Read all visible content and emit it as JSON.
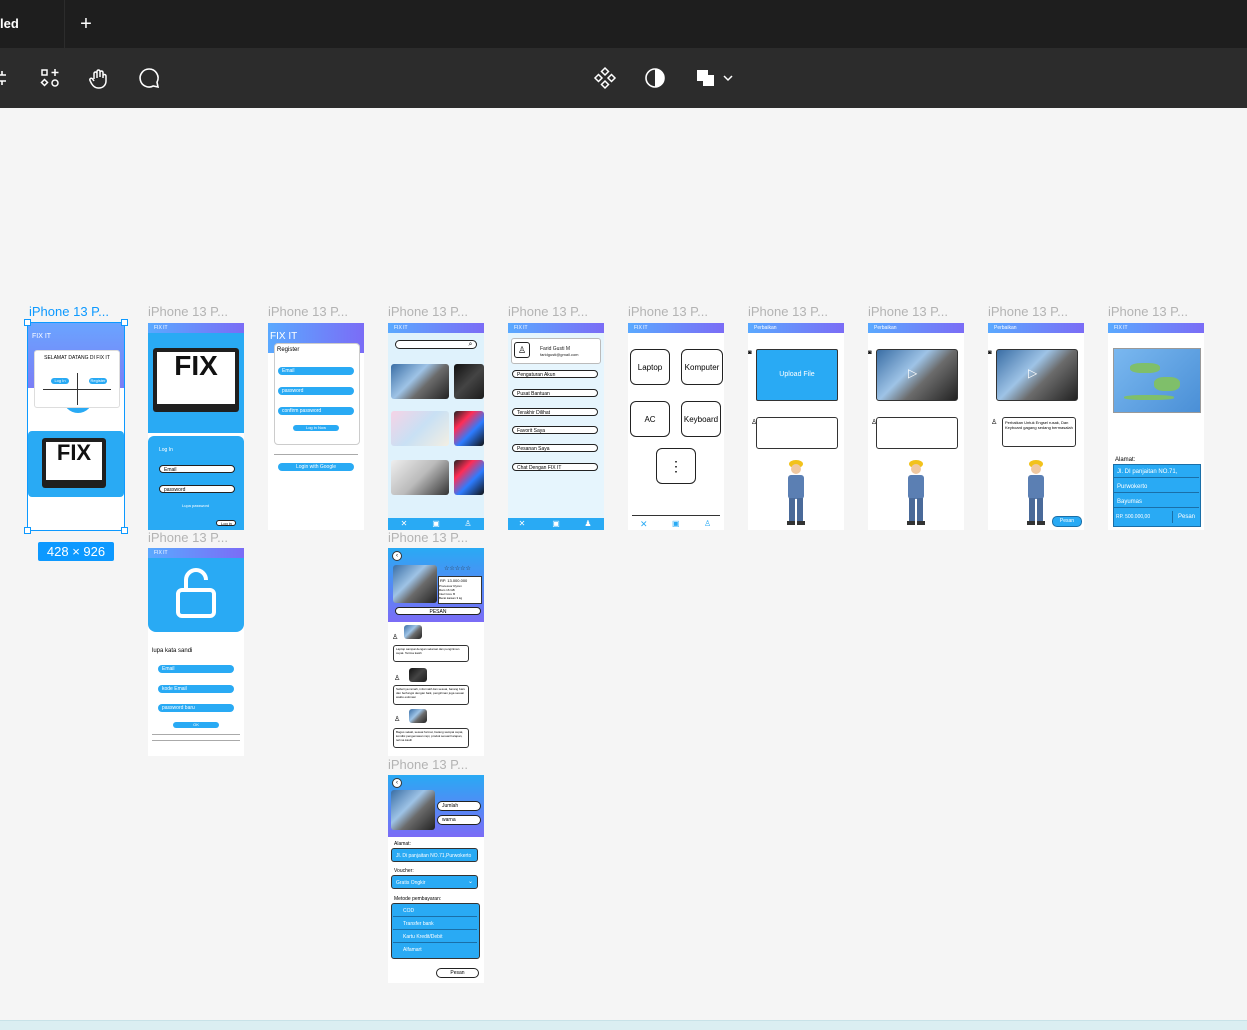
{
  "tabs": {
    "active": "led",
    "add": "+"
  },
  "toolbar": {
    "left_icons": [
      "frame-icon",
      "components-icon",
      "hand-icon",
      "comment-icon"
    ],
    "right_icons": [
      "component-diamond-icon",
      "contrast-icon",
      "boolean-shapes-icon",
      "chevron-down-icon"
    ]
  },
  "frames": {
    "label": "iPhone 13 P...",
    "dimensions": "428 × 926"
  },
  "f1": {
    "brand": "FIX IT",
    "welcome": "SELAMAT DATANG DI FIX IT",
    "login": "Log In",
    "register": "Register"
  },
  "f2": {
    "brand": "FIX IT",
    "title": "Log In",
    "email": "Email",
    "password": "password",
    "forgot": "Lupa password",
    "login": "Log in"
  },
  "f3": {
    "brand": "FIX IT",
    "title": "Register",
    "email": "Email",
    "password": "password",
    "confirm": "confirm password",
    "submit": "Log in Now",
    "google": "Login with Google"
  },
  "f4": {
    "brand": "FIX IT"
  },
  "f5": {
    "brand": "FIX IT",
    "user": "Farid Gusti M",
    "email": "faridgusti@gmail.com",
    "menu": [
      "Pengaturan Akun",
      "Pusat Bantuan",
      "Terakhir Dilihat",
      "Favorit Saya",
      "Pesanan Saya",
      "Chat Dengan FIX IT"
    ]
  },
  "f6": {
    "brand": "FIX IT",
    "tiles": [
      "Laptop",
      "Komputer",
      "AC",
      "Keyboard"
    ]
  },
  "f7": {
    "brand": "Perbaikan",
    "upload": "Upload File"
  },
  "f8": {
    "brand": "Perbaikan"
  },
  "f9": {
    "brand": "Perbaikan",
    "note": "Perbaikan Untuk Engsel rusak, Dan Keyboard gagang sedang bermasalah",
    "order": "Pesan"
  },
  "f10": {
    "brand": "FIX IT",
    "address_label": "Alamat:",
    "rows": [
      "Jl. DI panjaitan NO.71,",
      "Purwokerto",
      "Bayumas"
    ],
    "price": "RP. 500.000,00",
    "order": "Pesan"
  },
  "f11": {
    "brand": "FIX IT",
    "title": "lupa kata sandi",
    "email": "Email",
    "code": "kode Email",
    "newpass": "password baru",
    "submit": "OK"
  },
  "f12": {
    "rating": "☆☆☆☆☆",
    "price": "RP. 13.000.000",
    "specs": [
      "Processor Ryzen",
      "Ram 16 GB",
      "Intel Core i5",
      "Berat kaisan 3 kg"
    ],
    "order": "PESAN",
    "reviews": [
      "Laptop sampai dengan selamat dan pengiriman cepat. Terima kasih",
      "Sellernya ramah, informatif dan sesuai, barang baru dan berfungsi dengan baik, pengiriman juga sesuai waktu estimasi",
      "Bagus sekali, sesuai format, barang sampai cepat, kondisi pengemasan rapi, produk sesuai harapan, terima kasih"
    ]
  },
  "f13": {
    "qty": "Jumlah",
    "color": "warna",
    "address_label": "Alamat:",
    "address": "Jl. Di panjaitan NO.71,Purwokerto",
    "voucher_label": "Voucher:",
    "voucher": "Gratis Ongkir",
    "payment_label": "Metode pembayaran:",
    "payments": [
      "COD",
      "Transfer bank",
      "Kartu Kredit/Debit",
      "Alfamart"
    ],
    "order": "Pesan"
  }
}
